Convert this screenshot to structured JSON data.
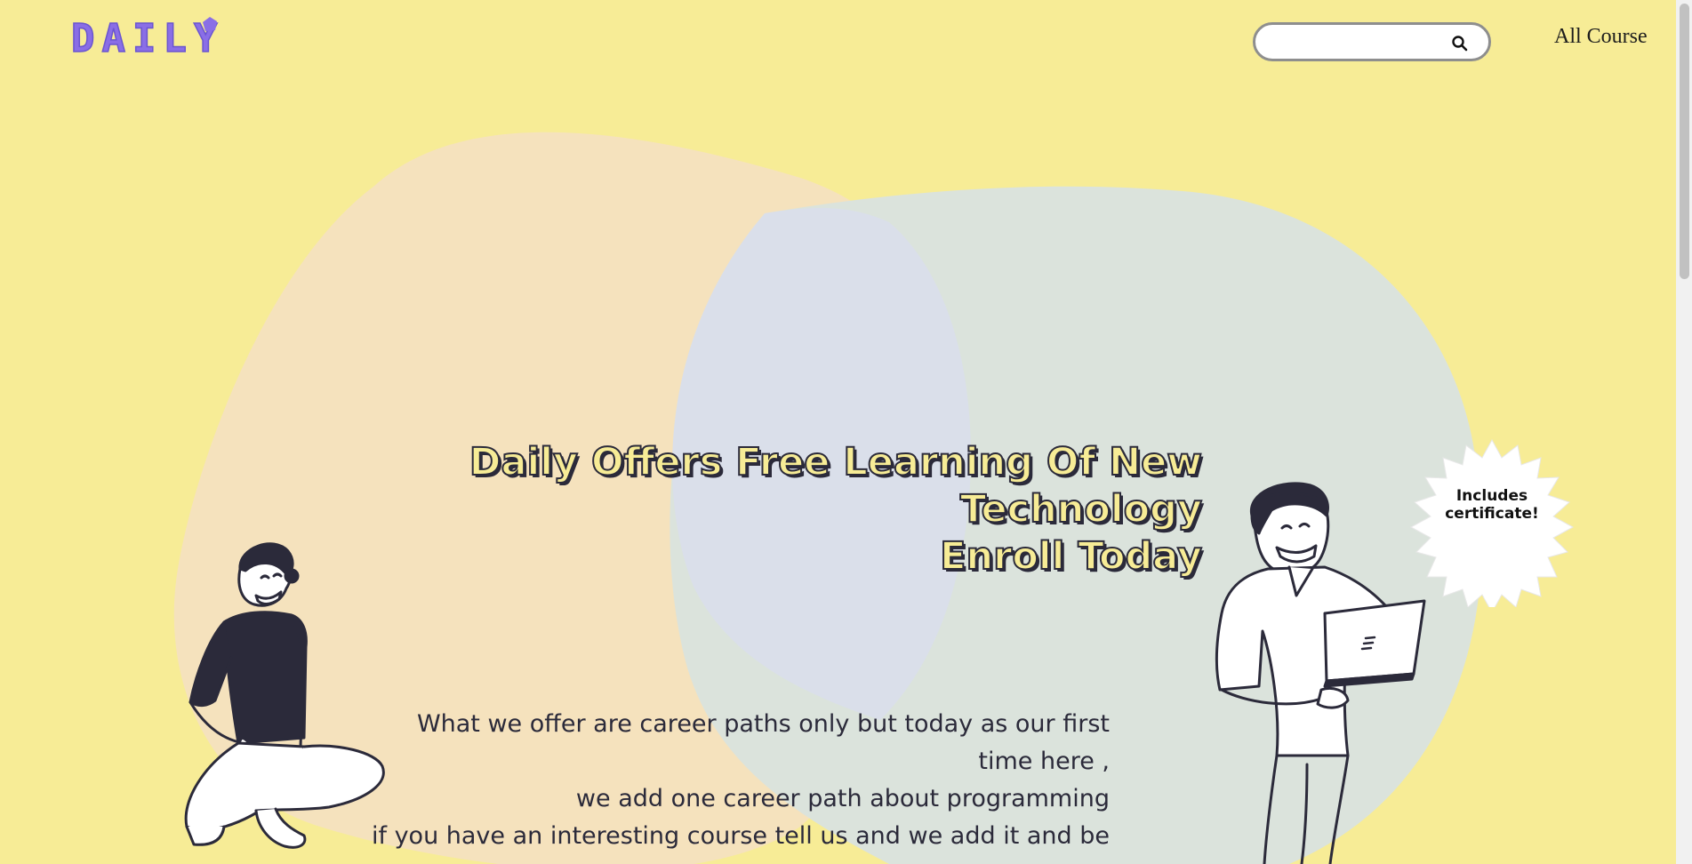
{
  "brand": {
    "logo_text": "DAILY"
  },
  "search": {
    "placeholder": "",
    "value": "",
    "icon": "search-icon"
  },
  "nav": {
    "all_course": "All Course"
  },
  "hero": {
    "headline_line1": "Daily Offers Free Learning Of New Technology",
    "headline_line2": "Enroll Today"
  },
  "description": {
    "line1": "What we offer are career paths only but today as our first time here ,",
    "line2": "we add one career path about programming",
    "line3": "if you have an interesting course tell us and we add it and be"
  },
  "badge": {
    "text": "Includes certificate!"
  },
  "colors": {
    "background": "#f7ec96",
    "blob_peach": "#f5e2bd",
    "blob_sage": "#dbe3dc",
    "blob_lavender": "#dadfea",
    "logo": "#8a6ee6",
    "ink": "#2b2a3a"
  }
}
